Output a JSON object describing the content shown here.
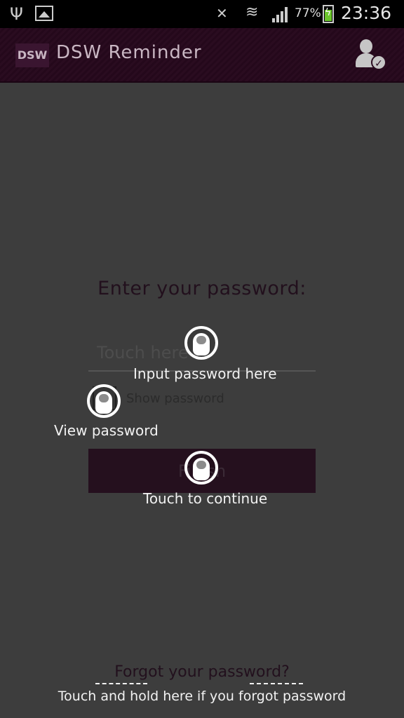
{
  "status_bar": {
    "battery_percent": "77%",
    "time": "23:36",
    "icons": [
      "usb-icon",
      "gallery-icon",
      "mute-icon",
      "wifi-icon",
      "signal-icon",
      "battery-charging-icon"
    ]
  },
  "app_bar": {
    "logo_text": "DSW",
    "title": "DSW Reminder",
    "action_icon": "user-check-icon"
  },
  "form": {
    "prompt": "Enter your password:",
    "password_placeholder": "Touch here",
    "show_password_label": "Show password",
    "show_password_checked": false,
    "finish_label": "Finish"
  },
  "tutorial": {
    "input_hint": "Input password here",
    "view_hint": "View password",
    "continue_hint": "Touch to continue",
    "forgot_hint": "Touch and hold here if you forgot password"
  },
  "footer": {
    "forgot_label": "Forgot your password?"
  },
  "colors": {
    "app_bar": "#2a0c20",
    "background": "#3d3d3d",
    "button": "#25101e",
    "hint_text": "#f2f2f2"
  }
}
